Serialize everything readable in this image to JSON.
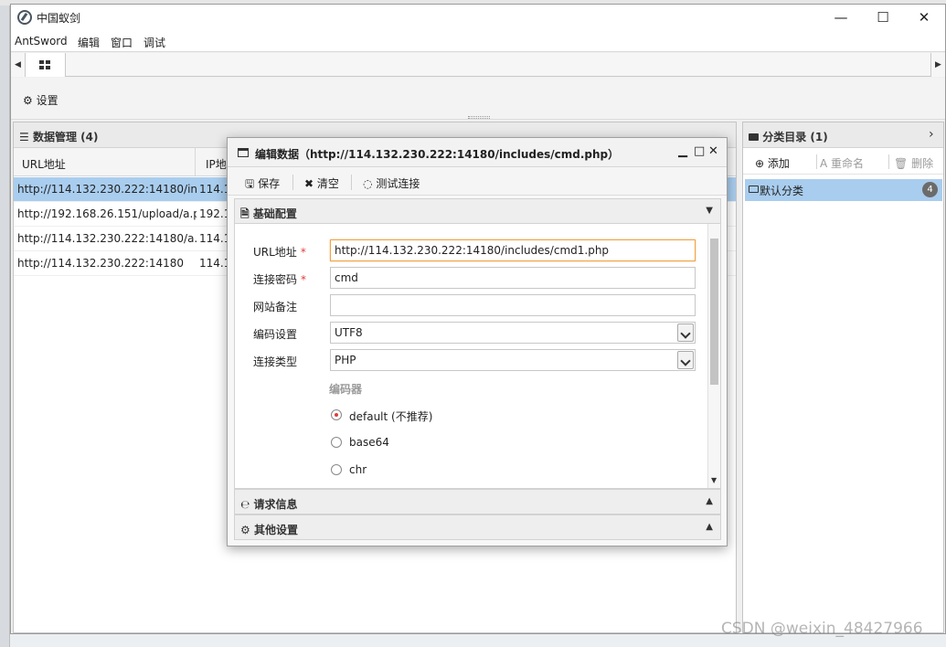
{
  "app": {
    "title": "中国蚁剑",
    "window_controls": {
      "minimize": "—",
      "maximize": "☐",
      "close": "✕"
    }
  },
  "menubar": {
    "items": [
      "AntSword",
      "编辑",
      "窗口",
      "调试"
    ]
  },
  "settings": {
    "label": "设置"
  },
  "data_panel": {
    "title": "数据管理 (4)",
    "columns": [
      "URL地址",
      "IP地"
    ],
    "rows": [
      {
        "url": "http://114.132.230.222:14180/inc",
        "ip": "114.1",
        "selected": true
      },
      {
        "url": "http://192.168.26.151/upload/a.p",
        "ip": "192.1",
        "selected": false
      },
      {
        "url": "http://114.132.230.222:14180/a.p",
        "ip": "114.1",
        "selected": false
      },
      {
        "url": "http://114.132.230.222:14180",
        "ip": "114.1",
        "selected": false
      }
    ]
  },
  "category_panel": {
    "title": "分类目录 (1)",
    "toolbar": {
      "add": "添加",
      "rename": "重命名",
      "delete": "删除"
    },
    "items": [
      {
        "label": "默认分类",
        "count": "4"
      }
    ]
  },
  "dialog": {
    "title": "编辑数据（http://114.132.230.222:14180/includes/cmd.php）",
    "toolbar": {
      "save": "保存",
      "clear": "清空",
      "test": "测试连接"
    },
    "sections": {
      "basic": "基础配置",
      "request": "请求信息",
      "other": "其他设置"
    },
    "form": {
      "url_label": "URL地址",
      "url_value": "http://114.132.230.222:14180/includes/cmd1.php",
      "password_label": "连接密码",
      "password_value": "cmd",
      "note_label": "网站备注",
      "note_value": "",
      "encoding_label": "编码设置",
      "encoding_value": "UTF8",
      "type_label": "连接类型",
      "type_value": "PHP",
      "encoder_legend": "编码器",
      "encoders": [
        "default (不推荐)",
        "base64",
        "chr"
      ],
      "required_mark": "*"
    }
  },
  "watermark": "CSDN @weixin_48427966",
  "colors": {
    "selection": "#a9cdee",
    "required": "#e23b3b",
    "focus_border": "#f0a347"
  }
}
